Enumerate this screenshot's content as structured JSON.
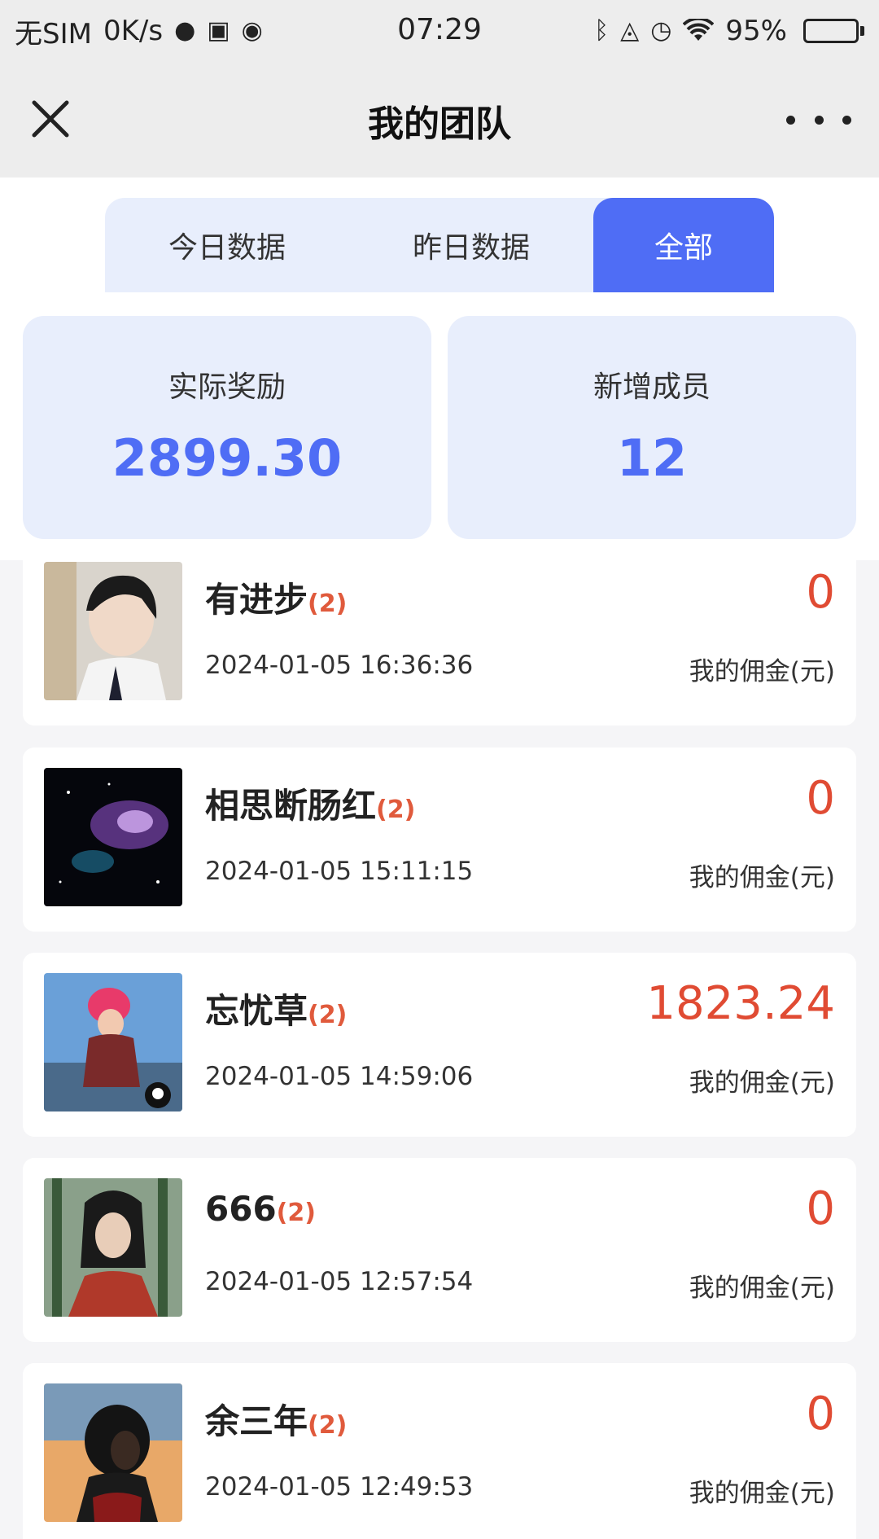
{
  "status_bar": {
    "carrier": "无SIM",
    "speed": "0K/s",
    "time": "07:29",
    "battery_pct": "95%",
    "battery_level": 0.95,
    "icons": [
      "planet-icon",
      "sim-card-icon",
      "media-icon",
      "bluetooth-icon",
      "bell-off-icon",
      "alarm-icon",
      "wifi-icon",
      "battery-icon"
    ]
  },
  "nav": {
    "title": "我的团队",
    "close_icon": "close-icon",
    "more_icon": "more-icon"
  },
  "tabs": [
    {
      "label": "今日数据",
      "active": false
    },
    {
      "label": "昨日数据",
      "active": false
    },
    {
      "label": "全部",
      "active": true
    }
  ],
  "stats": [
    {
      "label": "实际奖励",
      "value": "2899.30"
    },
    {
      "label": "新增成员",
      "value": "12"
    }
  ],
  "members": [
    {
      "name": "有进步",
      "count": "(2)",
      "date": "2024-01-05 16:36:36",
      "amount": "0",
      "amount_label": "我的佣金(元)"
    },
    {
      "name": "相思断肠红",
      "count": "(2)",
      "date": "2024-01-05 15:11:15",
      "amount": "0",
      "amount_label": "我的佣金(元)"
    },
    {
      "name": "忘忧草",
      "count": "(2)",
      "date": "2024-01-05 14:59:06",
      "amount": "1823.24",
      "amount_label": "我的佣金(元)"
    },
    {
      "name": "666",
      "count": "(2)",
      "date": "2024-01-05 12:57:54",
      "amount": "0",
      "amount_label": "我的佣金(元)"
    },
    {
      "name": "余三年",
      "count": "(2)",
      "date": "2024-01-05 12:49:53",
      "amount": "0",
      "amount_label": "我的佣金(元)"
    }
  ],
  "colors": {
    "accent": "#4f6df5",
    "card_bg": "#e8eefc",
    "amount_red": "#e04b33"
  }
}
